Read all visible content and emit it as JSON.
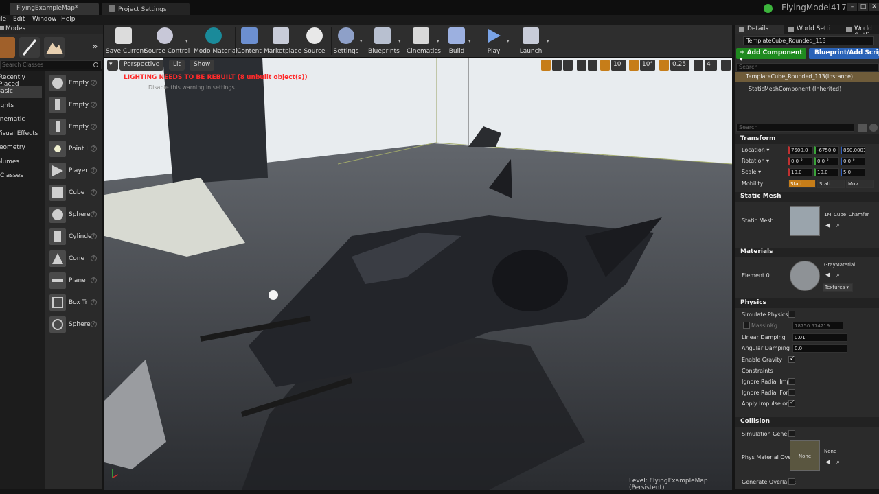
{
  "titlebar": {
    "tab_map": "FlyingExampleMap*",
    "tab_project": "Project Settings",
    "app_name": "FlyingModel417",
    "window_min": "–",
    "window_max": "□",
    "window_close": "✕"
  },
  "menu": [
    "File",
    "Edit",
    "Window",
    "Help"
  ],
  "modes": {
    "tab_label": "Modes",
    "search_placeholder": "Search Classes",
    "categories": [
      "Recently Placed",
      "Basic",
      "Lights",
      "Cinematic",
      "Visual Effects",
      "Geometry",
      "Volumes",
      "All Classes"
    ],
    "active_category": "Basic",
    "items": [
      "Empty",
      "Empty",
      "Empty",
      "Point L",
      "Player",
      "Cube",
      "Sphere",
      "Cylinde",
      "Cone",
      "Plane",
      "Box Tr",
      "Sphere"
    ],
    "help_glyph": "?"
  },
  "toolbar": {
    "buttons": [
      {
        "label": "Save Current",
        "icon": "save-icon"
      },
      {
        "label": "Source Control",
        "icon": "source-control-icon"
      },
      {
        "label": "Modo Material",
        "icon": "modo-icon"
      },
      {
        "label": "Content",
        "icon": "content-icon"
      },
      {
        "label": "Marketplace",
        "icon": "marketplace-icon"
      },
      {
        "label": "Source",
        "icon": "source-icon"
      },
      {
        "label": "Settings",
        "icon": "settings-icon"
      },
      {
        "label": "Blueprints",
        "icon": "blueprints-icon"
      },
      {
        "label": "Cinematics",
        "icon": "cinematics-icon"
      },
      {
        "label": "Build",
        "icon": "build-icon"
      },
      {
        "label": "Play",
        "icon": "play-icon"
      },
      {
        "label": "Launch",
        "icon": "launch-icon"
      }
    ]
  },
  "viewport": {
    "perspective": "Perspective",
    "lit": "Lit",
    "show": "Show",
    "warning": "LIGHTING NEEDS TO BE REBUILT (8 unbuilt object(s))",
    "warning_sub": "Disable this warning in settings",
    "grid_snap": "10",
    "rot_snap": "10°",
    "scale_snap": "0.25",
    "camera_speed": "4",
    "level_label": "Level:",
    "level_name": "FlyingExampleMap (Persistent)"
  },
  "right_tabs": [
    "Details",
    "World Setti",
    "World Outli"
  ],
  "details": {
    "object_name": "TemplateCube_Rounded_113",
    "add_component": "+ Add Component ▾",
    "blueprint_script": "Blueprint/Add Script",
    "search_placeholder": "Search",
    "instance_row": "TemplateCube_Rounded_113(Instance)",
    "static_row": "StaticMeshComponent (Inherited)",
    "prop_search_placeholder": "Search",
    "transform": {
      "section": "Transform",
      "location_label": "Location ▾",
      "location": [
        "7500.0",
        "-6750.0",
        "850.0001"
      ],
      "rotation_label": "Rotation ▾",
      "rotation": [
        "0.0 °",
        "0.0 °",
        "0.0 °"
      ],
      "scale_label": "Scale ▾",
      "scale": [
        "10.0",
        "10.0",
        "5.0"
      ],
      "mobility_label": "Mobility",
      "mobility": [
        "Stati",
        "Stati",
        "Mov"
      ]
    },
    "static_mesh": {
      "section": "Static Mesh",
      "label": "Static Mesh",
      "mesh_name": "1M_Cube_Chamfer"
    },
    "materials": {
      "section": "Materials",
      "label": "Element 0",
      "material_name": "GrayMaterial",
      "textures": "Textures ▾"
    },
    "physics": {
      "section": "Physics",
      "simulate_label": "Simulate Physics",
      "mass_label": "MassInKg",
      "mass_value": "18750.574219",
      "linear_label": "Linear Damping",
      "linear_value": "0.01",
      "angular_label": "Angular Damping",
      "angular_value": "0.0",
      "gravity_label": "Enable Gravity",
      "constraints_label": "Constraints",
      "radial_impulse_label": "Ignore Radial Impu",
      "radial_force_label": "Ignore Radial Force",
      "apply_impulse_label": "Apply Impulse on D"
    },
    "collision": {
      "section": "Collision",
      "sim_gen_label": "Simulation Genera",
      "phys_mat_label": "Phys Material Ove",
      "phys_mat_value": "None",
      "phys_mat_thumb": "None",
      "gen_overlap_label": "Generate Overlap E"
    }
  },
  "colors": {
    "accent_orange": "#c67d19",
    "add_component_green": "#1f8a1f",
    "blueprint_blue": "#2a63b8",
    "warning_red": "#ff2a2a"
  }
}
